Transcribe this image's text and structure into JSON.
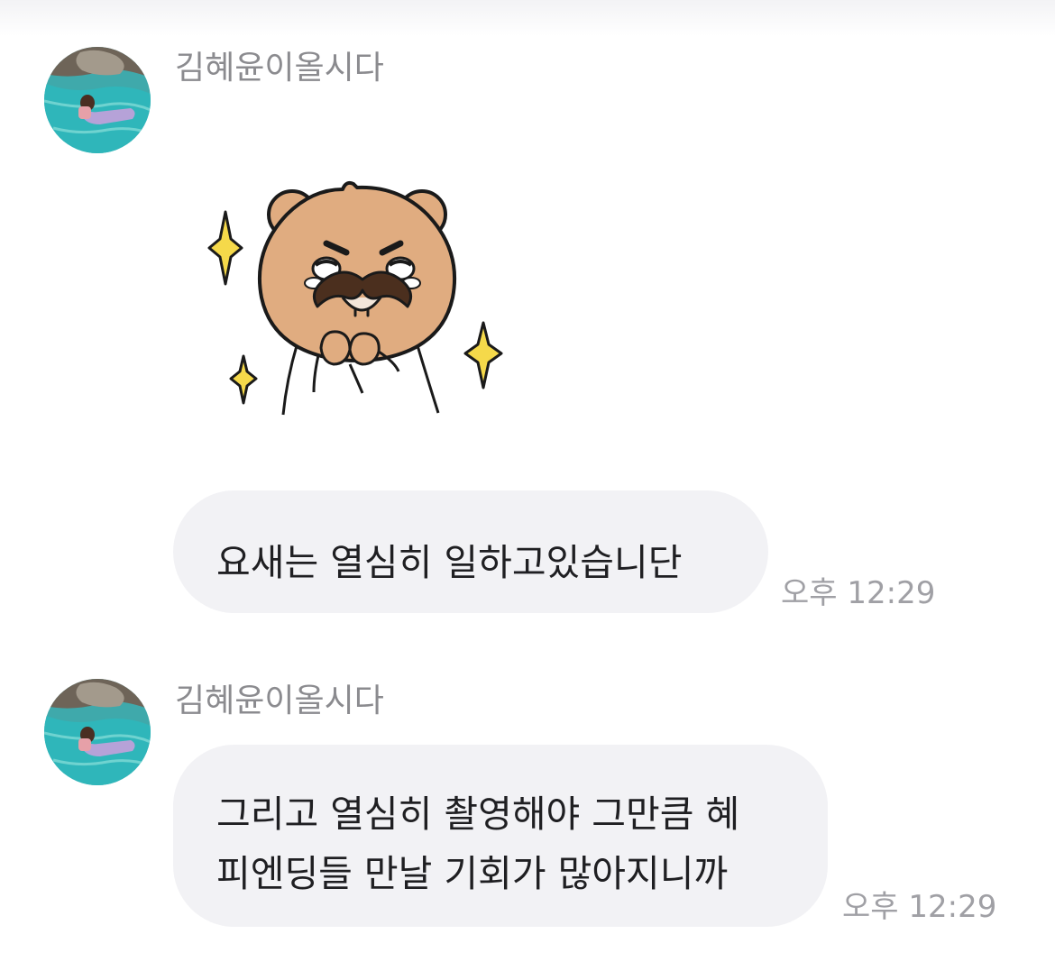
{
  "messages": [
    {
      "sender": "김혜윤이올시다",
      "type": "sticker",
      "sticker_icon": "bear-with-mustache-sticker"
    },
    {
      "sender": "김혜윤이올시다",
      "type": "text",
      "text": "요새는 열심히 일하고있습니단",
      "time": "오후 12:29"
    },
    {
      "sender": "김혜윤이올시다",
      "type": "text",
      "text": "그리고 열심히 촬영해야 그만큼 혜\n피엔딩들 만날 기회가 많아지니까",
      "time": "오후 12:29"
    }
  ],
  "colors": {
    "bubble": "#f2f2f5",
    "sender_name": "#8b8b8f",
    "timestamp": "#a0a0a5",
    "message_text": "#1f1f22"
  }
}
